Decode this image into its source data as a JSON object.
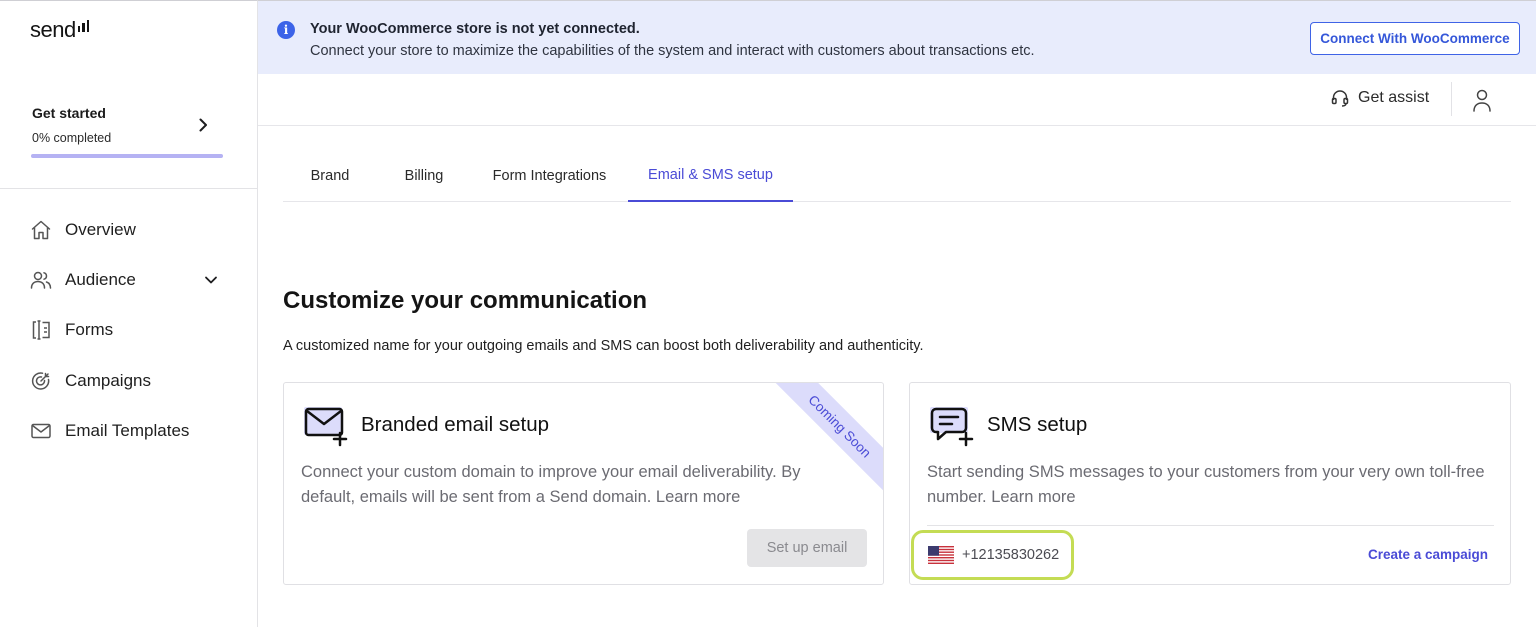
{
  "brand": {
    "logo_text": "send"
  },
  "sidebar": {
    "get_started": {
      "title": "Get started",
      "progress_text": "0% completed",
      "progress": 0
    },
    "items": [
      {
        "label": "Overview",
        "icon": "home-icon"
      },
      {
        "label": "Audience",
        "icon": "users-icon",
        "expandable": true
      },
      {
        "label": "Forms",
        "icon": "form-icon"
      },
      {
        "label": "Campaigns",
        "icon": "target-icon"
      },
      {
        "label": "Email Templates",
        "icon": "mail-icon"
      }
    ]
  },
  "banner": {
    "title": "Your WooCommerce store is not yet connected.",
    "description": "Connect your store to maximize the capabilities of the system and interact with customers about transactions etc.",
    "button_label": "Connect With WooCommerce",
    "accent": "#3f63e6",
    "background": "#e8ecfc"
  },
  "topbar": {
    "assist_label": "Get assist"
  },
  "tabs": [
    {
      "label": "Brand",
      "active": false
    },
    {
      "label": "Billing",
      "active": false
    },
    {
      "label": "Form Integrations",
      "active": false
    },
    {
      "label": "Email & SMS setup",
      "active": true
    }
  ],
  "main": {
    "heading": "Customize your communication",
    "subtext": "A customized name for your outgoing emails and SMS can boost both deliverability and authenticity.",
    "email_card": {
      "title": "Branded email setup",
      "description": "Connect your custom domain to improve your email deliverability. By default, emails will be sent from a Send domain. Learn more",
      "ribbon": "Coming Soon",
      "button_label": "Set up email",
      "button_disabled": true
    },
    "sms_card": {
      "title": "SMS setup",
      "description": "Start sending SMS messages to your customers from your very own toll-free number. Learn more",
      "phone_number": "+12135830262",
      "flag": "us-flag-icon",
      "link_label": "Create a campaign"
    }
  },
  "colors": {
    "accent": "#4a4bd6",
    "highlight": "#c4dc54"
  }
}
